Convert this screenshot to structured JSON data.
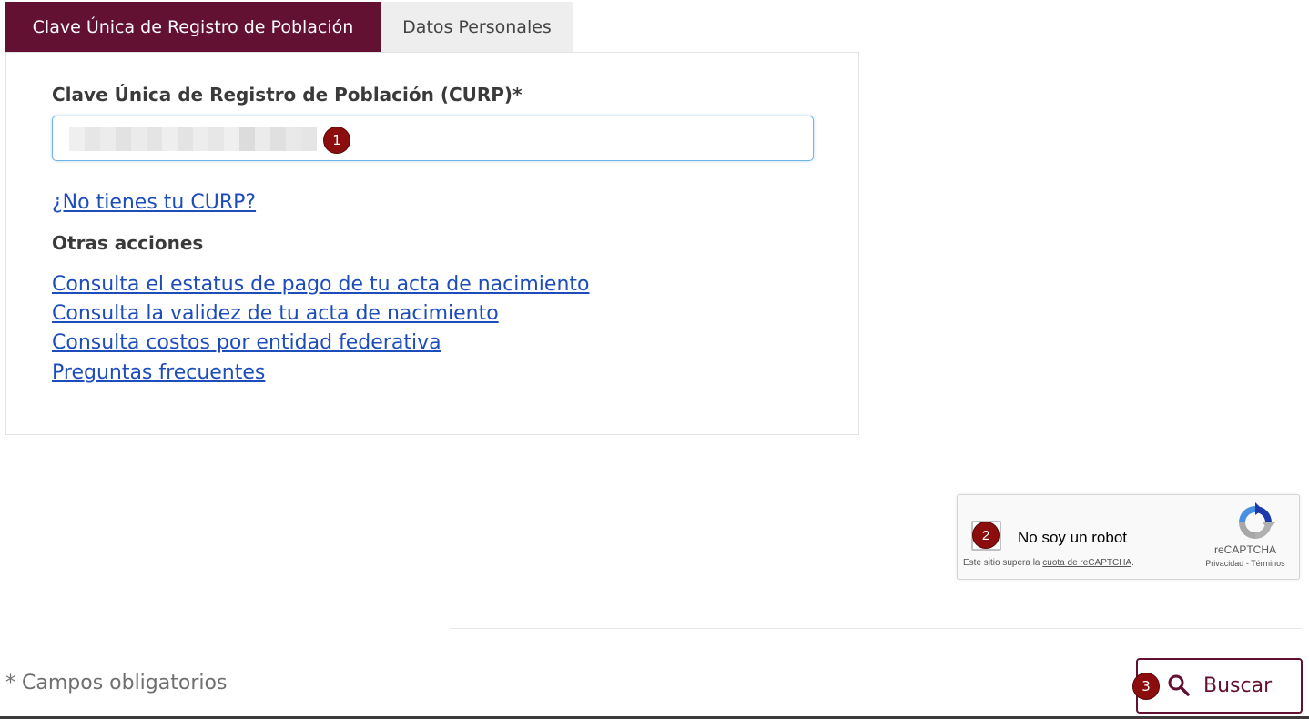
{
  "tabs": {
    "curp": "Clave Única de Registro de Población",
    "personal_data": "Datos Personales"
  },
  "form": {
    "curp_label": "Clave Única de Registro de Población (CURP)*",
    "curp_value_note": "blurred",
    "no_curp_link": "¿No tienes tu CURP?",
    "other_actions_title": "Otras acciones",
    "links": [
      "Consulta el estatus de pago de tu acta de nacimiento",
      "Consulta la validez de tu acta de nacimiento",
      "Consulta costos por entidad federativa",
      "Preguntas frecuentes"
    ]
  },
  "recaptcha": {
    "label": "No soy un robot",
    "brand": "reCAPTCHA",
    "privacy": "Privacidad",
    "separator": " - ",
    "terms": "Términos",
    "quota_prefix": "Este sitio supera la ",
    "quota_link": "cuota de reCAPTCHA",
    "quota_suffix": "."
  },
  "footer": {
    "required_note": "* Campos obligatorios",
    "search_label": "Buscar"
  },
  "markers": {
    "one": "1",
    "two": "2",
    "three": "3"
  },
  "colors": {
    "brand": "#621132",
    "link": "#1d4dbb",
    "marker": "#8b0d0d"
  }
}
